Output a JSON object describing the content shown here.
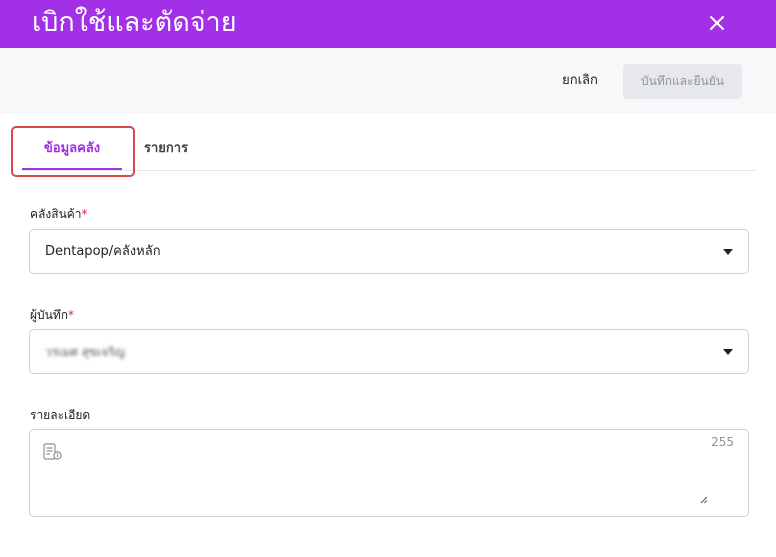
{
  "header": {
    "title": "เบิกใช้และตัดจ่าย"
  },
  "actions": {
    "cancel_label": "ยกเลิก",
    "confirm_label": "บันทึกและยืนยัน"
  },
  "tabs": [
    {
      "label": "ข้อมูลคลัง",
      "active": true
    },
    {
      "label": "รายการ",
      "active": false
    }
  ],
  "form": {
    "warehouse": {
      "label": "คลังสินค้า",
      "required_mark": "*",
      "value": "Dentapop/คลังหลัก"
    },
    "recorder": {
      "label": "ผู้บันทึก",
      "required_mark": "*",
      "value": "วรเมศ สุขเจริญ"
    },
    "details": {
      "label": "รายละเอียด",
      "value": "",
      "char_limit": "255"
    }
  },
  "colors": {
    "brand": "#a230e6",
    "required": "#d6283a",
    "highlight_frame": "#d64949"
  }
}
